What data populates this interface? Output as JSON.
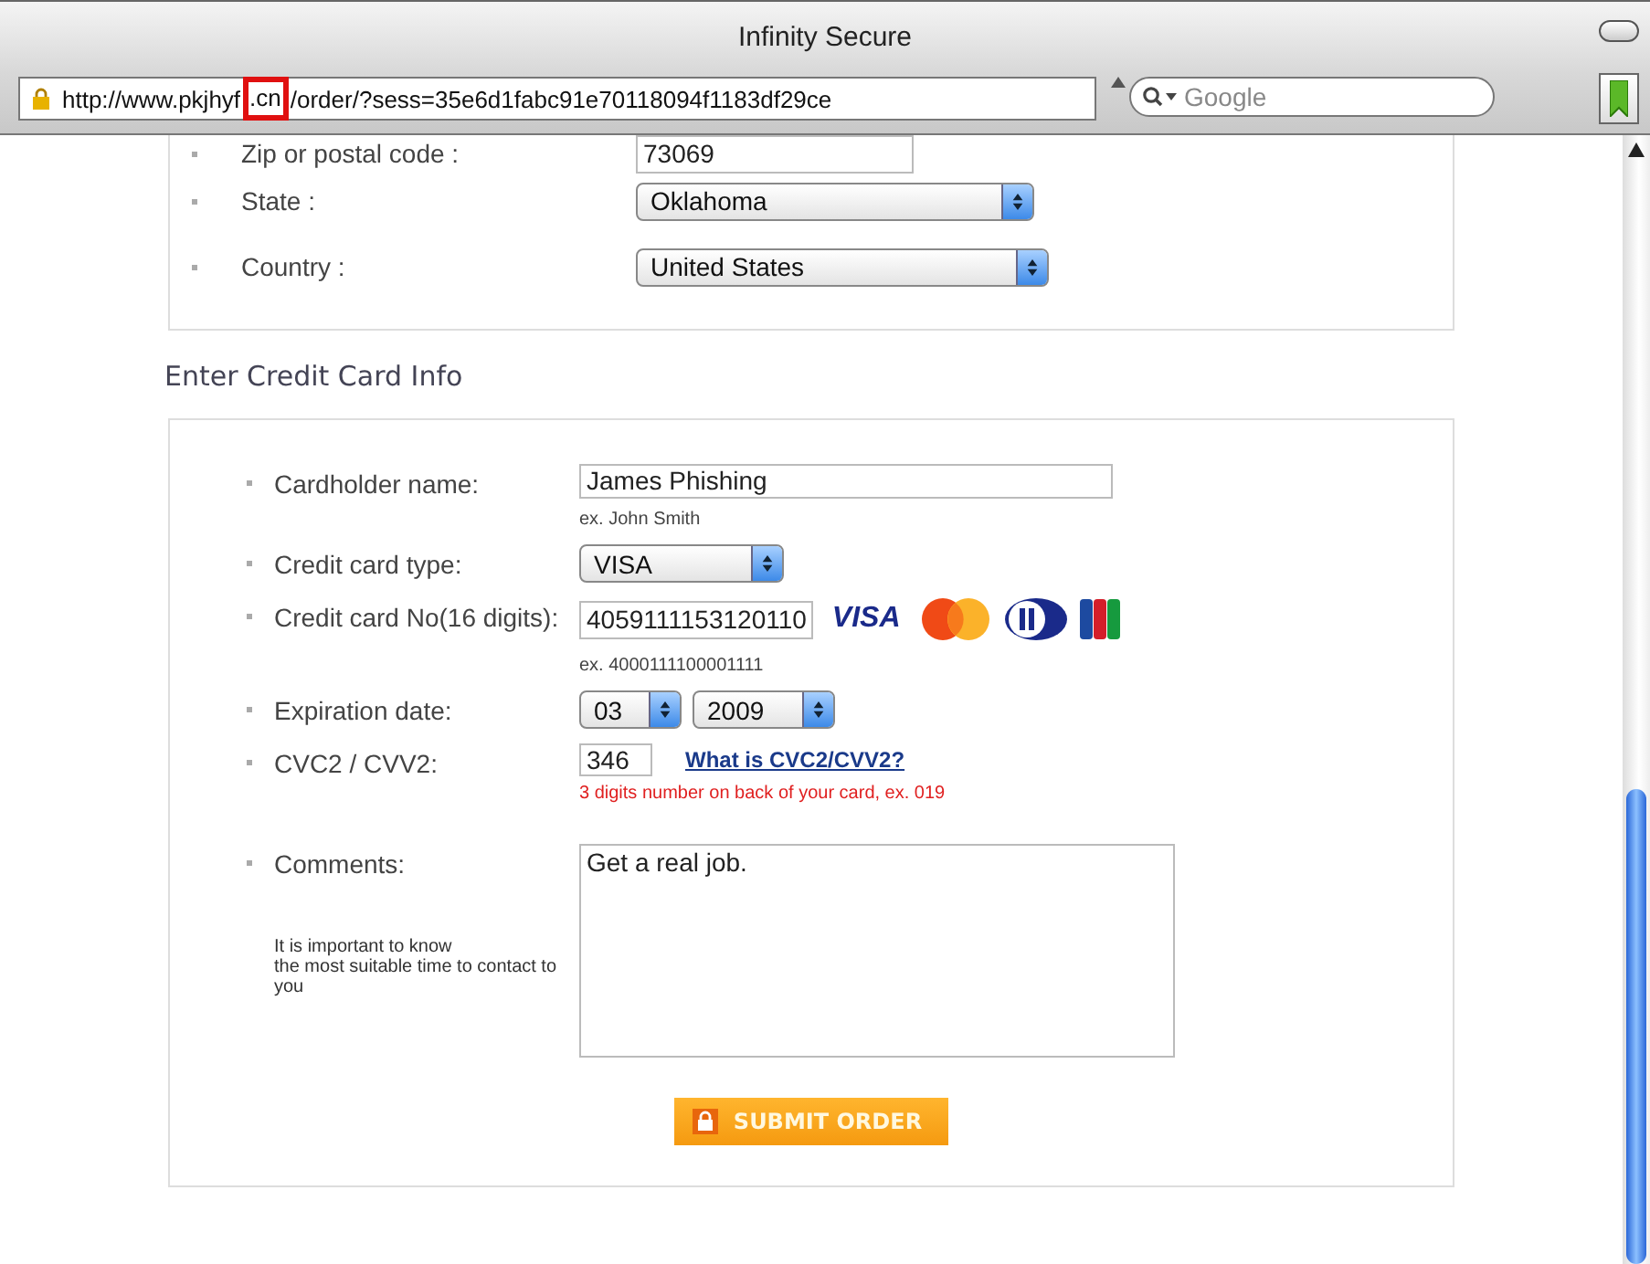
{
  "window": {
    "title": "Infinity Secure"
  },
  "address_bar": {
    "url_before": "http://www.pkjhyf",
    "url_highlight": ".cn",
    "url_after": "/order/?sess=35e6d1fabc91e70118094f1183df29ce"
  },
  "search": {
    "placeholder": "Google"
  },
  "address_section": {
    "fields": [
      {
        "kind": "text",
        "label": "Zip or postal code :",
        "value": "73069"
      },
      {
        "kind": "select",
        "label": "State :",
        "value": "Oklahoma"
      },
      {
        "kind": "select",
        "label": "Country :",
        "value": "United States"
      }
    ]
  },
  "card_section": {
    "title": "Enter Credit Card Info",
    "fields": [
      {
        "kind": "text",
        "label": "Cardholder name:",
        "value": "James Phishing",
        "hint": "ex. John Smith"
      },
      {
        "kind": "select",
        "label": "Credit card type:",
        "value": "VISA"
      },
      {
        "kind": "card_number",
        "label": "Credit card No(16 digits):",
        "value": "4059111153120110",
        "hint": "ex. 4000111100001111",
        "logos": [
          {
            "kind": "visa",
            "text": "VISA"
          },
          {
            "kind": "mastercard"
          },
          {
            "kind": "diners"
          },
          {
            "kind": "jcb"
          }
        ]
      },
      {
        "kind": "select_pair",
        "label": "Expiration date:",
        "values": [
          "03",
          "2009"
        ]
      },
      {
        "kind": "cvc",
        "label": "CVC2 / CVV2:",
        "value": "346",
        "link": "What is CVC2/CVV2?",
        "error_hint": "3 digits number on back of your card, ex. 019"
      },
      {
        "kind": "textarea",
        "label": "Comments:",
        "value": "Get a real job.",
        "description": "It is important to know\nthe most suitable time to contact to you"
      }
    ],
    "submit": {
      "label": "SUBMIT ORDER"
    }
  }
}
